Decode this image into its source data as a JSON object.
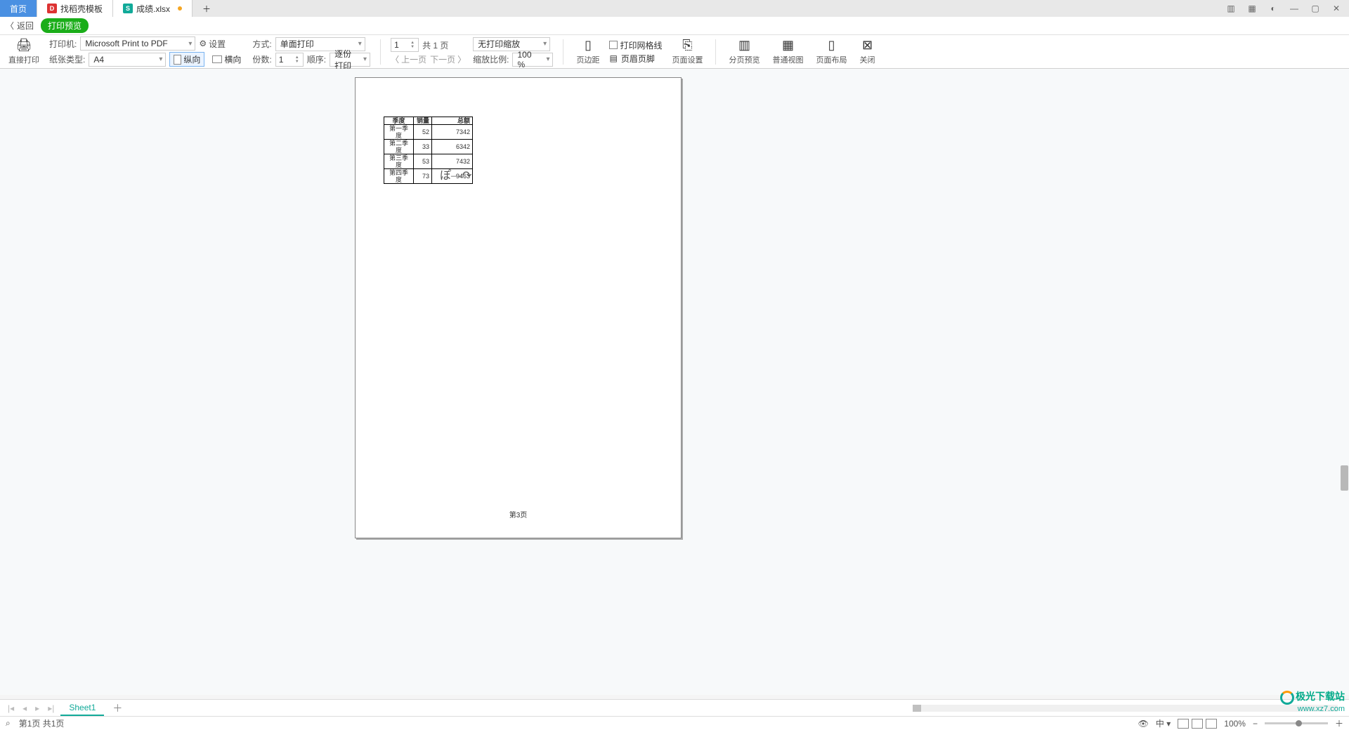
{
  "tabs": {
    "home": "首页",
    "template": "找稻壳模板",
    "file": "成绩.xlsx"
  },
  "header": {
    "back": "返回",
    "preview": "打印预览"
  },
  "toolbar": {
    "direct_print": "直接打印",
    "printer_label": "打印机:",
    "printer_value": "Microsoft Print to PDF",
    "settings": "设置",
    "paper_label": "纸张类型:",
    "paper_value": "A4",
    "portrait": "纵向",
    "landscape": "横向",
    "mode_label": "方式:",
    "mode_value": "单面打印",
    "copies_label": "份数:",
    "copies_value": "1",
    "order_label": "顺序:",
    "order_value": "逐份打印",
    "page_value": "1",
    "page_total": "共 1 页",
    "prev_page": "上一页",
    "next_page": "下一页",
    "scale_label": "缩放比例:",
    "scale_value": "100 %",
    "noscale": "无打印缩放",
    "margins": "页边距",
    "gridlines": "打印网格线",
    "header_footer": "页眉页脚",
    "page_setup": "页面设置",
    "page_break": "分页预览",
    "normal_view": "普通视图",
    "page_layout": "页面布局",
    "close": "关闭"
  },
  "preview": {
    "headers": [
      "季度",
      "销量",
      "总额"
    ],
    "rows": [
      [
        "第一季度",
        "52",
        "7342"
      ],
      [
        "第二季度",
        "33",
        "6342"
      ],
      [
        "第三季度",
        "53",
        "7432"
      ],
      [
        "第四季度",
        "73",
        "9463"
      ]
    ],
    "footer": "第3页"
  },
  "sheets": {
    "sheet1": "Sheet1"
  },
  "status": {
    "page_info": "第1页 共1页",
    "lang": "中",
    "zoom": "100%"
  },
  "watermark": {
    "brand": "极光下载站",
    "url": "www.xz7.com"
  }
}
